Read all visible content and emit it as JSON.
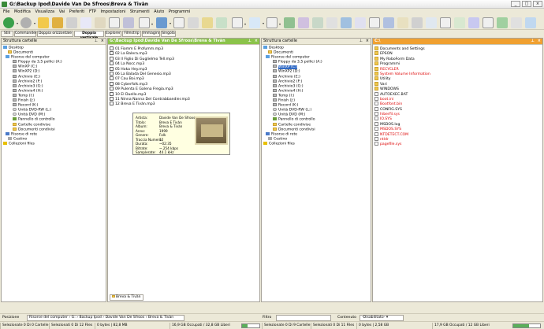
{
  "window": {
    "title": "G:\\Backup Ipod\\Davide Van De Sfroos\\Breva & Tivàn"
  },
  "menu": [
    "File",
    "Modifica",
    "Visualizza",
    "Vai",
    "Preferiti",
    "FTP",
    "Impostazioni",
    "Strumenti",
    "Aiuto",
    "Programmi"
  ],
  "tabs": [
    "Stili",
    "Commander",
    "Doppia orizzontale",
    "Doppia verticale",
    "Explorer",
    "Filmstrip",
    "Immagini",
    "Singola"
  ],
  "left_tree": {
    "header": "Struttura cartelle",
    "rows": [
      {
        "label": "Desktop",
        "icon": "desktop-icon"
      },
      {
        "label": "Documenti",
        "icon": "folder-icon"
      },
      {
        "label": "Risorse del computer",
        "icon": "computer-icon"
      },
      {
        "label": "Floppy da 3,5 pollici (A:)",
        "icon": "drive-icon"
      },
      {
        "label": "WinXP (C:)",
        "icon": "drive-icon"
      },
      {
        "label": "WinXP2 (D:)",
        "icon": "drive-icon"
      },
      {
        "label": "Archivio (E:)",
        "icon": "drive-icon"
      },
      {
        "label": "Archivio2 (F:)",
        "icon": "drive-icon"
      },
      {
        "label": "Archivio3 (G:)",
        "icon": "drive-icon"
      },
      {
        "label": "Archivio4 (H:)",
        "icon": "drive-icon"
      },
      {
        "label": "Temp (I:)",
        "icon": "drive-icon"
      },
      {
        "label": "Finish (J:)",
        "icon": "drive-icon"
      },
      {
        "label": "Record (K:)",
        "icon": "drive-icon"
      },
      {
        "label": "Unità DVD-RW (L:)",
        "icon": "cd-icon"
      },
      {
        "label": "Unità DVD (M:)",
        "icon": "cd-icon"
      },
      {
        "label": "Pannello di controllo",
        "icon": "control-panel-icon"
      },
      {
        "label": "Cartelle condivise",
        "icon": "folder-icon"
      },
      {
        "label": "Documenti condivisi",
        "icon": "folder-icon"
      },
      {
        "label": "Risorse di rete",
        "icon": "network-icon"
      },
      {
        "label": "Cestino",
        "icon": "recycle-bin-icon"
      },
      {
        "label": "Collezioni files",
        "icon": "star-icon"
      }
    ]
  },
  "file_pane": {
    "header": "G:\\Backup Ipod\\Davide Van De Sfroos\\Breva & Tivàn",
    "files": [
      "01 Fiomm E Profumm.mp3",
      "02 La Balera.mp3",
      "03 Il Figlio Di Guglielmo Tell.mp3",
      "04 La Nocc.mp3",
      "05 Hoka Hey.mp3",
      "06 La Balada Del Genesio.mp3",
      "07 Cau Boi.mp3",
      "08 Cyberfolk.mp3",
      "09 Pulenta E Galena Fregia.mp3",
      "10 El Duello.mp3",
      "11 Ninna Nanna Del Contrabbandier.mp3",
      "12 Breva E Tivàn.mp3"
    ],
    "bottom_tab": "Breva & Tivàn"
  },
  "tooltip": {
    "rows": [
      {
        "k": "Artista:",
        "v": "Davide Van De Sfroos"
      },
      {
        "k": "Titolo:",
        "v": "Breva E Tivàn"
      },
      {
        "k": "Album:",
        "v": "Breva & Tivàn"
      },
      {
        "k": "Anno:",
        "v": "1999"
      },
      {
        "k": "Genere:",
        "v": "Folk"
      },
      {
        "k": "Traccia Numero:",
        "v": "12"
      },
      {
        "k": "Durata:",
        "v": "~02:35"
      },
      {
        "k": "Bitrate:",
        "v": "~.254 kbps"
      },
      {
        "k": "Samplerate:",
        "v": "44.1 kHz"
      }
    ]
  },
  "right_tree": {
    "header": "Struttura cartelle",
    "selected": "WinXP (C:)"
  },
  "right_files": {
    "header": "C:\\",
    "items": [
      {
        "label": "Documents and Settings",
        "color": "normal",
        "icon": "folder-icon"
      },
      {
        "label": "EPSON",
        "color": "normal",
        "icon": "folder-icon"
      },
      {
        "label": "My RoboForm Data",
        "color": "normal",
        "icon": "folder-icon"
      },
      {
        "label": "Programmi",
        "color": "normal",
        "icon": "folder-icon"
      },
      {
        "label": "RECYCLER",
        "color": "red",
        "icon": "folder-icon"
      },
      {
        "label": "System Volume Information",
        "color": "red",
        "icon": "folder-icon"
      },
      {
        "label": "Utility",
        "color": "normal",
        "icon": "folder-icon"
      },
      {
        "label": "Vari",
        "color": "normal",
        "icon": "folder-icon"
      },
      {
        "label": "WINDOWS",
        "color": "normal",
        "icon": "folder-icon"
      },
      {
        "label": "AUTOEXEC.BAT",
        "color": "normal",
        "icon": "file-icon"
      },
      {
        "label": "boot.ini",
        "color": "red",
        "icon": "file-icon"
      },
      {
        "label": "Bootfont.bin",
        "color": "red",
        "icon": "file-icon"
      },
      {
        "label": "CONFIG.SYS",
        "color": "normal",
        "icon": "file-icon"
      },
      {
        "label": "hiberfil.sys",
        "color": "red",
        "icon": "file-icon"
      },
      {
        "label": "IO.SYS",
        "color": "red",
        "icon": "file-icon"
      },
      {
        "label": "MSDOS.log",
        "color": "normal",
        "icon": "file-icon"
      },
      {
        "label": "MSDOS.SYS",
        "color": "red",
        "icon": "file-icon"
      },
      {
        "label": "NTDETECT.COM",
        "color": "red",
        "icon": "file-icon"
      },
      {
        "label": "ntldr",
        "color": "red",
        "icon": "file-icon"
      },
      {
        "label": "pagefile.sys",
        "color": "red",
        "icon": "file-icon"
      }
    ]
  },
  "address": {
    "label": "Posizione",
    "crumbs": [
      "Risorse del computer",
      "G:",
      "Backup Ipod",
      "Davide Van De Sfroos",
      "Breva & Tivàn"
    ],
    "filter_label": "Filtro",
    "content_label": "Contenuto",
    "content_value": "-Disabilitato-"
  },
  "status": {
    "left": [
      "Selezionate 0 Di 0 Cartelle",
      "Selezionati 0 Di 12 Files",
      "0 bytes | 82,8 MB",
      "16,9 GB Occupati / 32,8 GB Liberi"
    ],
    "left_used_percent": 34,
    "right": [
      "Selezionate 0 Di 9 Cartelle",
      "Selezionati 0 Di 11 Files",
      "0 bytes | 2,58 GB",
      "17,9 GB Occupati / 12 GB Liberi"
    ],
    "right_used_percent": 60
  }
}
